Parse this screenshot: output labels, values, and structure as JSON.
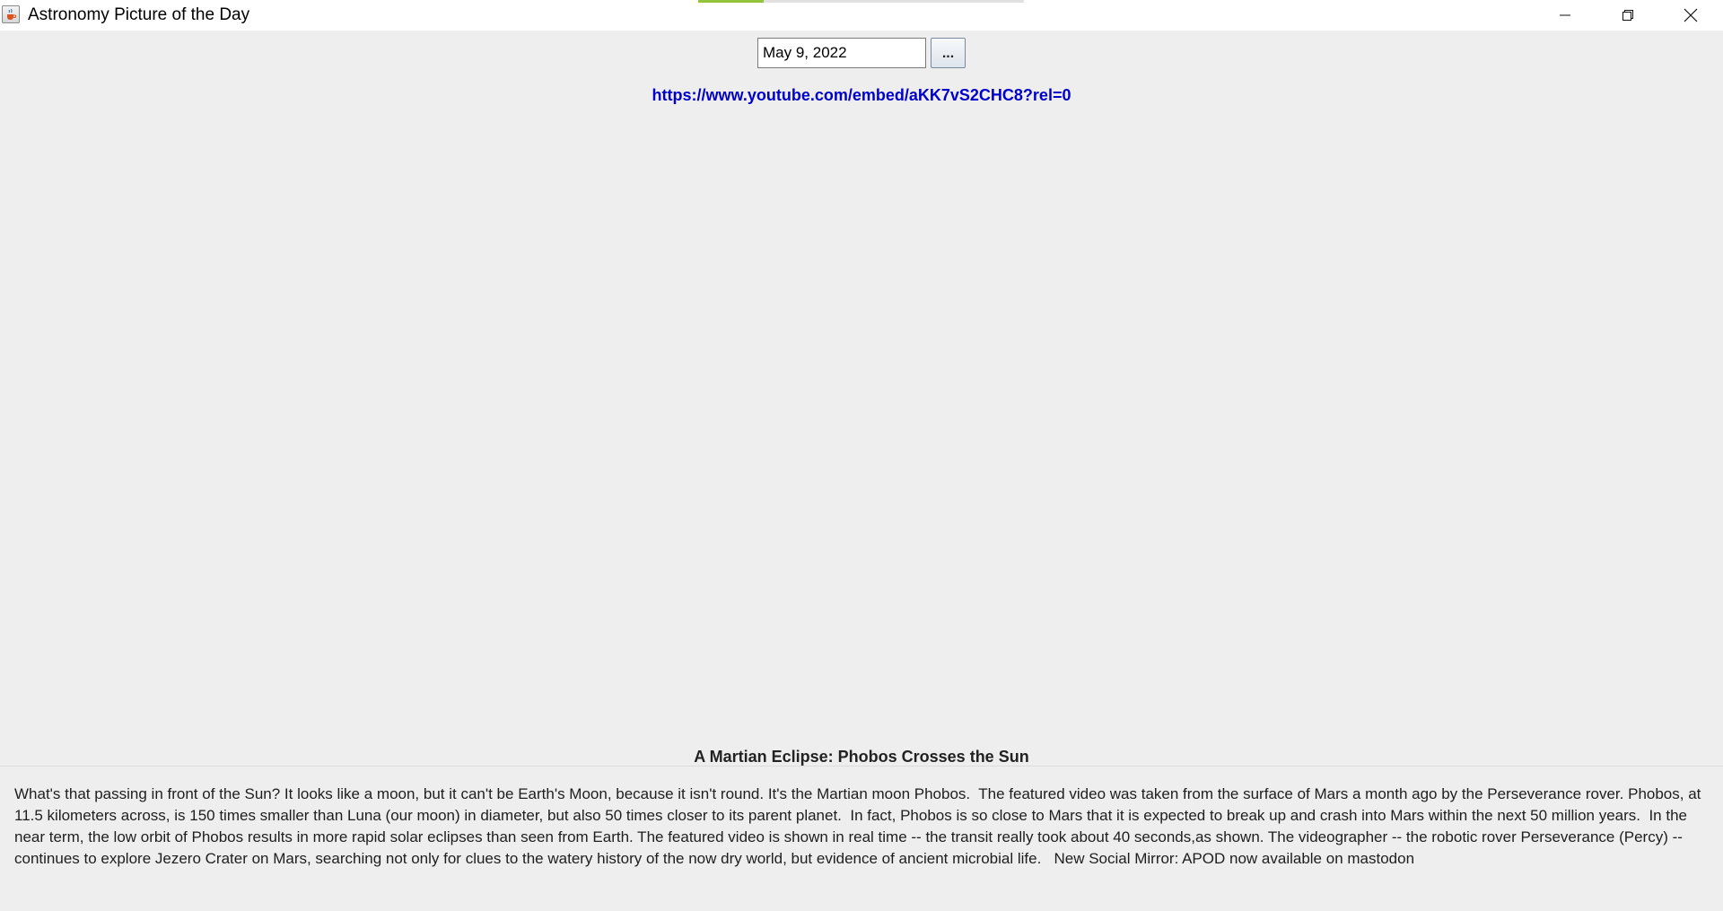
{
  "window": {
    "title": "Astronomy Picture of the Day",
    "loading_progress": 0.2
  },
  "date_picker": {
    "value": "May 9, 2022",
    "button_label": "..."
  },
  "media": {
    "url": "https://www.youtube.com/embed/aKK7vS2CHC8?rel=0"
  },
  "apod": {
    "title": "A Martian Eclipse: Phobos Crosses the Sun",
    "explanation": "What's that passing in front of the Sun? It looks like a moon, but it can't be Earth's Moon, because it isn't round. It's the Martian moon Phobos.  The featured video was taken from the surface of Mars a month ago by the Perseverance rover. Phobos, at 11.5 kilometers across, is 150 times smaller than Luna (our moon) in diameter, but also 50 times closer to its parent planet.  In fact, Phobos is so close to Mars that it is expected to break up and crash into Mars within the next 50 million years.  In the near term, the low orbit of Phobos results in more rapid solar eclipses than seen from Earth. The featured video is shown in real time -- the transit really took about 40 seconds,as shown. The videographer -- the robotic rover Perseverance (Percy) -- continues to explore Jezero Crater on Mars, searching not only for clues to the watery history of the now dry world, but evidence of ancient microbial life.   New Social Mirror: APOD now available on mastodon"
  },
  "icons": {
    "app": "java-cup-icon",
    "minimize": "minimize-icon",
    "maximize": "restore-icon",
    "close": "close-icon"
  },
  "colors": {
    "link": "#0000cc",
    "background": "#eeeeee",
    "progress": "#93c43c"
  }
}
